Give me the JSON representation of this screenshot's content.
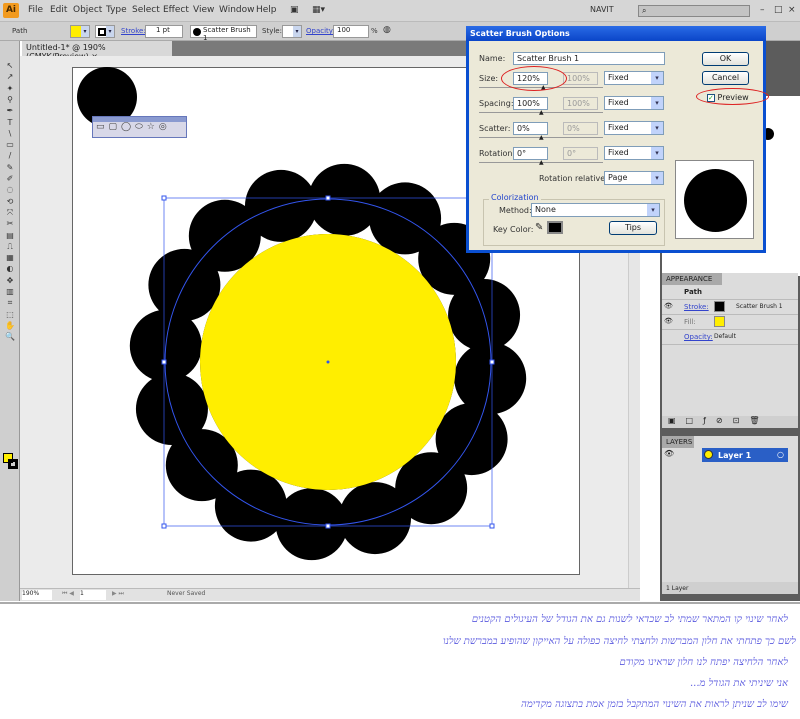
{
  "menubar": {
    "logo": "Ai",
    "items": [
      "File",
      "Edit",
      "Object",
      "Type",
      "Select",
      "Effect",
      "View",
      "Window",
      "Help"
    ],
    "workspace": "NAVIT",
    "search_placeholder": ""
  },
  "controlbar": {
    "selection": "Path",
    "fill_color": "#ffee00",
    "stroke_label": "Stroke:",
    "stroke_weight": "1 pt",
    "brush": "Scatter Brush 1",
    "style_label": "Style:",
    "opacity_label": "Opacity:",
    "opacity_value": "100",
    "percent": "%"
  },
  "document": {
    "tab_title": "Untitled-1* @ 190% (CMYK/Preview)",
    "close": "×"
  },
  "statusbar": {
    "zoom": "190%",
    "artboard": "1",
    "status": "Never Saved"
  },
  "dialog": {
    "title": "Scatter Brush Options",
    "name_label": "Name:",
    "name_value": "Scatter Brush 1",
    "rows": [
      {
        "label": "Size:",
        "value": "120%",
        "max": "100%",
        "mode": "Fixed"
      },
      {
        "label": "Spacing:",
        "value": "100%",
        "max": "100%",
        "mode": "Fixed"
      },
      {
        "label": "Scatter:",
        "value": "0%",
        "max": "0%",
        "mode": "Fixed"
      },
      {
        "label": "Rotation:",
        "value": "0°",
        "max": "0°",
        "mode": "Fixed"
      }
    ],
    "rotation_relative_label": "Rotation relative to:",
    "rotation_relative_value": "Page",
    "colorization_label": "Colorization",
    "method_label": "Method:",
    "method_value": "None",
    "key_color_label": "Key Color:",
    "tips": "Tips",
    "ok": "OK",
    "cancel": "Cancel",
    "preview_label": "Preview",
    "preview_checked": true
  },
  "appearance": {
    "title": "APPEARANCE",
    "object": "Path",
    "stroke_label": "Stroke:",
    "stroke_value": "Scatter Brush 1",
    "fill_label": "Fill:",
    "opacity_label": "Opacity:",
    "opacity_value": "Default"
  },
  "layers": {
    "title": "LAYERS",
    "layer_name": "Layer 1",
    "count": "1 Layer"
  },
  "colors": {
    "yellow": "#ffee00",
    "selection": "#3355ee",
    "annotation": "#dd2222"
  },
  "notes": [
    "לאחר שינוי קו המתאר שמתי לב שכדאי לשנות גם את הגודל של העיגולים הקטנים",
    "לשם כך פתחתי את חלון המברשות ולחצתי לחיצה כפולה על האייקון שהופיע במברשת שלנו",
    "לאחר הלחיצה יפתח לנו חלון שראינו מקודם",
    "אני שיניתי את הגודל מ...",
    "שימו לב שניתן לראות את השינוי המתקבל בזמן אמת בתצוגה מקדימה"
  ]
}
